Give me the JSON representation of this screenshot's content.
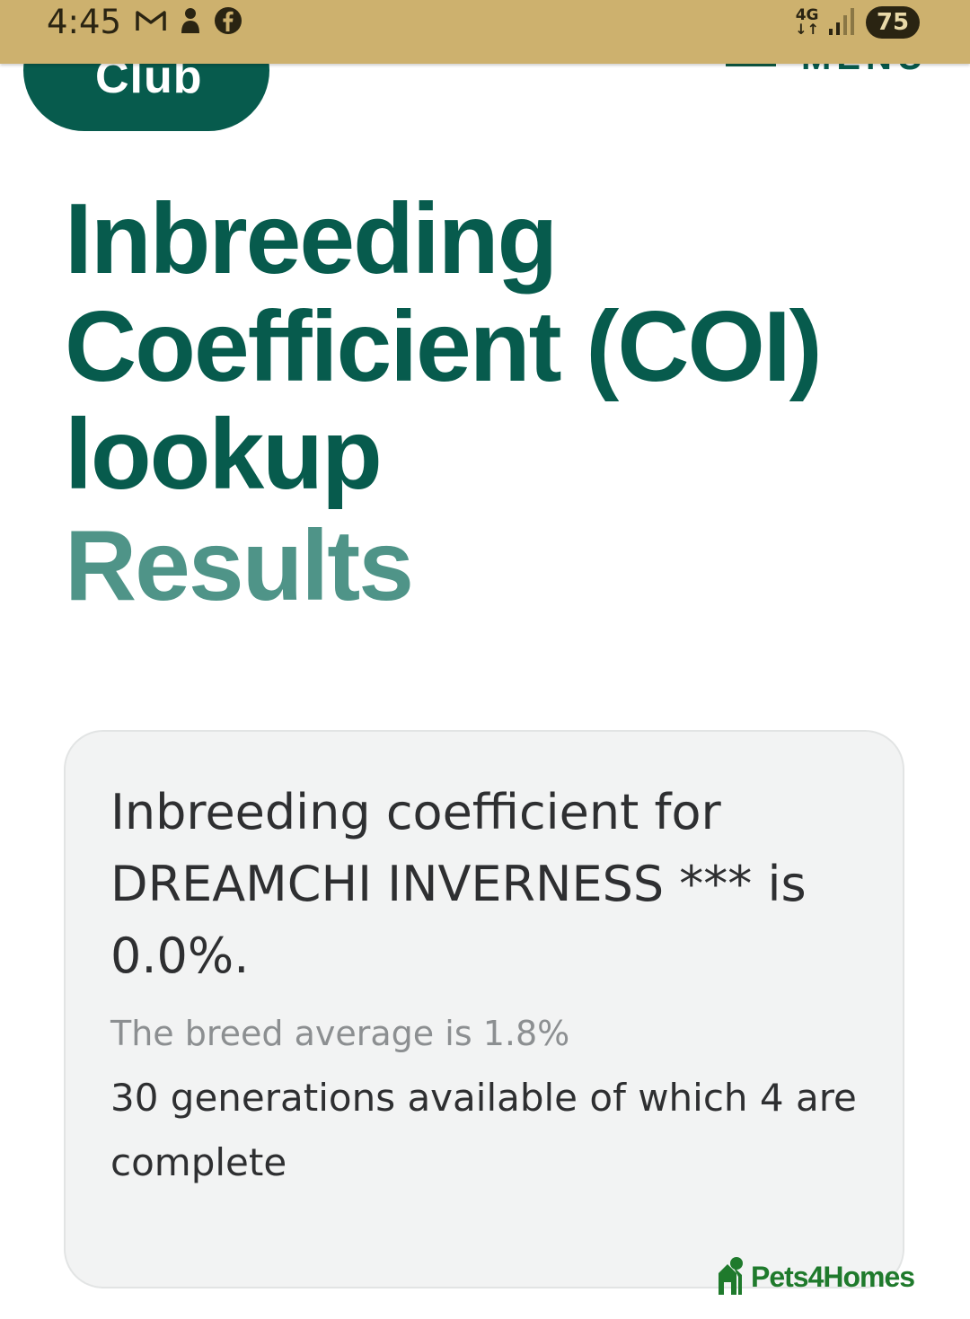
{
  "status_bar": {
    "time": "4:45",
    "left_icons": [
      "gmail-icon",
      "notification-app-icon",
      "facebook-icon"
    ],
    "network": "4G",
    "battery": "75"
  },
  "header": {
    "club_label": "Club",
    "menu_label": "MENU"
  },
  "page": {
    "title": "Inbreeding Coefficient (COI) lookup",
    "subtitle": "Results"
  },
  "result_card": {
    "result_text": "Inbreeding coefficient for DREAMCHI INVERNESS *** is 0.0%.",
    "breed_average": "The breed average is 1.8%",
    "generations": "30 generations available of which 4 are complete"
  },
  "watermark": {
    "text": "Pets4Homes"
  },
  "colors": {
    "brand_dark": "#075b4d",
    "brand_light": "#4f9488",
    "status_bar": "#cdb16e",
    "card_bg": "#f2f3f3"
  }
}
